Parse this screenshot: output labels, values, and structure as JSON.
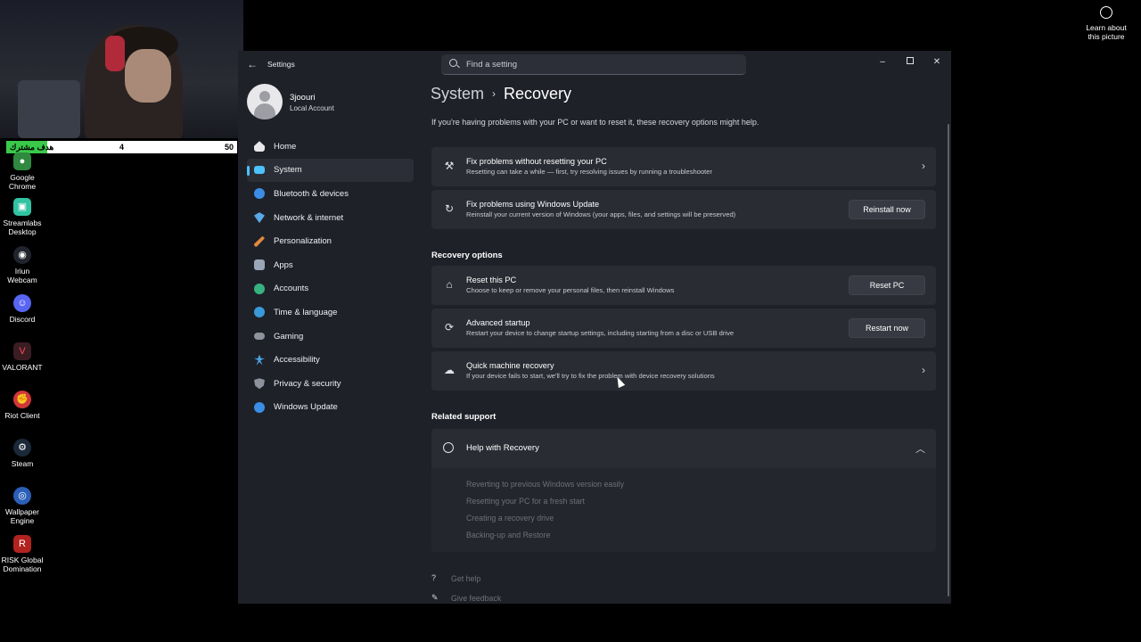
{
  "overlay": {
    "goal": {
      "label": "هدف مشترك",
      "current": "4",
      "max": "50"
    },
    "learn_about": "Learn about this picture"
  },
  "desktop": {
    "icons": [
      {
        "label": "Google Chrome",
        "icon": "chrome-icon",
        "color": "#2f8a3f"
      },
      {
        "label": "Streamlabs Desktop",
        "icon": "streamlabs-icon",
        "color": "#31c3a2"
      },
      {
        "label": "Iriun Webcam",
        "icon": "webcam-icon",
        "color": "#20242c"
      },
      {
        "label": "Discord",
        "icon": "discord-icon",
        "color": "#5865f2"
      },
      {
        "label": "VALORANT",
        "icon": "valorant-icon",
        "color": "#ff4655"
      },
      {
        "label": "Riot Client",
        "icon": "riot-icon",
        "color": "#d13639"
      },
      {
        "label": "Steam",
        "icon": "steam-icon",
        "color": "#1b2838"
      },
      {
        "label": "Wallpaper Engine",
        "icon": "wallpaper-engine-icon",
        "color": "#2b5fb8"
      },
      {
        "label": "RISK Global Domination",
        "icon": "risk-icon",
        "color": "#b2231f"
      }
    ]
  },
  "window": {
    "title": "Settings",
    "search_placeholder": "Find a setting",
    "controls": {
      "minimize": "–",
      "close": "✕"
    }
  },
  "profile": {
    "name": "3joouri",
    "account_type": "Local Account"
  },
  "sidebar": {
    "items": [
      {
        "label": "Home",
        "icon": "home-icon",
        "color": "#e8e8ea"
      },
      {
        "label": "System",
        "icon": "system-icon",
        "color": "#4cc2ff",
        "active": true
      },
      {
        "label": "Bluetooth & devices",
        "icon": "bluetooth-icon",
        "color": "#3a8ee6"
      },
      {
        "label": "Network & internet",
        "icon": "network-icon",
        "color": "#5aa9e6"
      },
      {
        "label": "Personalization",
        "icon": "personalization-icon",
        "color": "#e08a3c"
      },
      {
        "label": "Apps",
        "icon": "apps-icon",
        "color": "#9aa6b8"
      },
      {
        "label": "Accounts",
        "icon": "accounts-icon",
        "color": "#36b37e"
      },
      {
        "label": "Time & language",
        "icon": "time-language-icon",
        "color": "#3a9ad9"
      },
      {
        "label": "Gaming",
        "icon": "gaming-icon",
        "color": "#8d929c"
      },
      {
        "label": "Accessibility",
        "icon": "accessibility-icon",
        "color": "#4aa3df"
      },
      {
        "label": "Privacy & security",
        "icon": "shield-icon",
        "color": "#8d929c"
      },
      {
        "label": "Windows Update",
        "icon": "windows-update-icon",
        "color": "#3a8ee6"
      }
    ]
  },
  "page": {
    "breadcrumb_parent": "System",
    "breadcrumb_separator": "›",
    "title": "Recovery",
    "intro": "If you're having problems with your PC or want to reset it, these recovery options might help.",
    "fix_cards": [
      {
        "title": "Fix problems without resetting your PC",
        "desc": "Resetting can take a while — first, try resolving issues by running a troubleshooter",
        "icon": "wrench-icon"
      },
      {
        "title": "Fix problems using Windows Update",
        "desc": "Reinstall your current version of Windows (your apps, files, and settings will be preserved)",
        "icon": "refresh-icon",
        "button": "Reinstall now"
      }
    ],
    "recovery_options_heading": "Recovery options",
    "recovery_options": [
      {
        "title": "Reset this PC",
        "desc": "Choose to keep or remove your personal files, then reinstall Windows",
        "icon": "reset-pc-icon",
        "button": "Reset PC"
      },
      {
        "title": "Advanced startup",
        "desc": "Restart your device to change startup settings, including starting from a disc or USB drive",
        "icon": "advanced-startup-icon",
        "button": "Restart now"
      },
      {
        "title": "Quick machine recovery",
        "desc": "If your device fails to start, we'll try to fix the problem with device recovery solutions",
        "icon": "cloud-icon"
      }
    ],
    "related_support_heading": "Related support",
    "help": {
      "title": "Help with Recovery",
      "links": [
        "Reverting to previous Windows version easily",
        "Resetting your PC for a fresh start",
        "Creating a recovery drive",
        "Backing-up and Restore"
      ]
    },
    "footer": {
      "get_help": "Get help",
      "give_feedback": "Give feedback"
    }
  }
}
